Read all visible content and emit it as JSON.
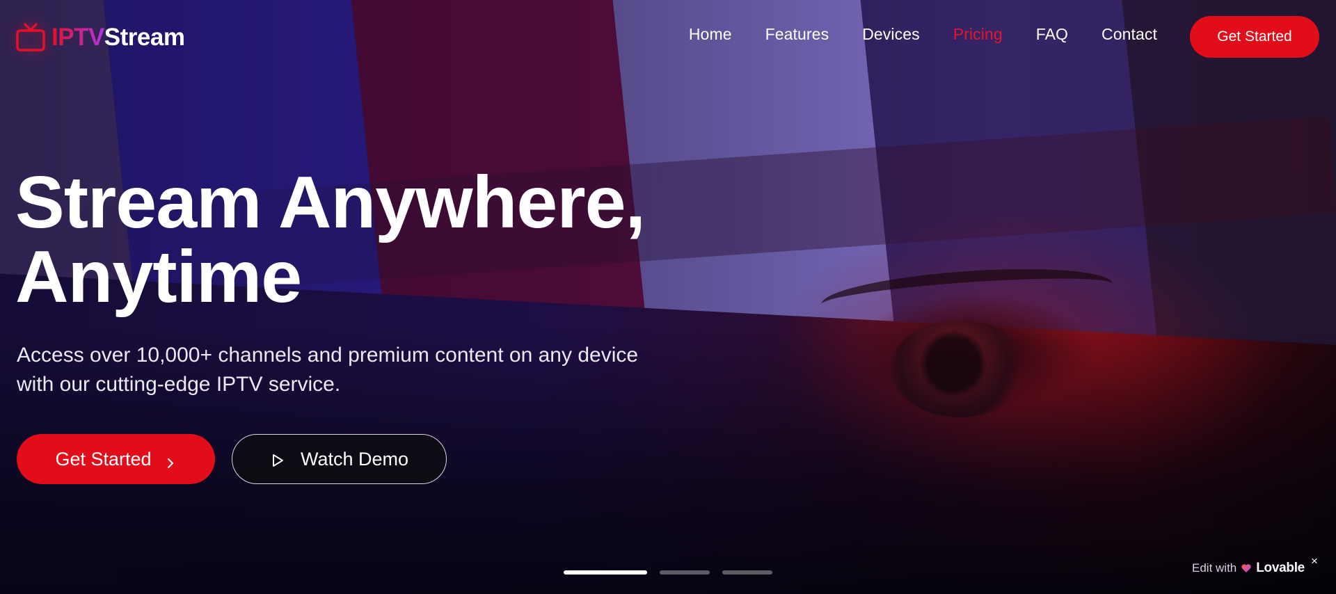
{
  "brand": {
    "logo_prefix": "IPTV",
    "logo_suffix": "Stream",
    "icon": "tv-icon",
    "accent_color": "#e30d1a"
  },
  "nav": {
    "items": [
      {
        "label": "Home",
        "active": false
      },
      {
        "label": "Features",
        "active": false
      },
      {
        "label": "Devices",
        "active": false
      },
      {
        "label": "Pricing",
        "active": true
      },
      {
        "label": "FAQ",
        "active": false
      },
      {
        "label": "Contact",
        "active": false
      }
    ],
    "cta_label": "Get Started"
  },
  "hero": {
    "headline_line1": "Stream Anywhere,",
    "headline_line2": "Anytime",
    "subtitle_line1": "Access over 10,000+ channels and premium content on any device",
    "subtitle_line2": "with our cutting-edge IPTV service.",
    "primary_button": {
      "label": "Get Started",
      "icon": "chevron-right-icon"
    },
    "secondary_button": {
      "label": "Watch Demo",
      "icon": "play-icon"
    }
  },
  "carousel": {
    "slide_count": 3,
    "active_index": 0
  },
  "badge": {
    "prefix": "Edit with",
    "brand": "Lovable",
    "close": "×"
  }
}
